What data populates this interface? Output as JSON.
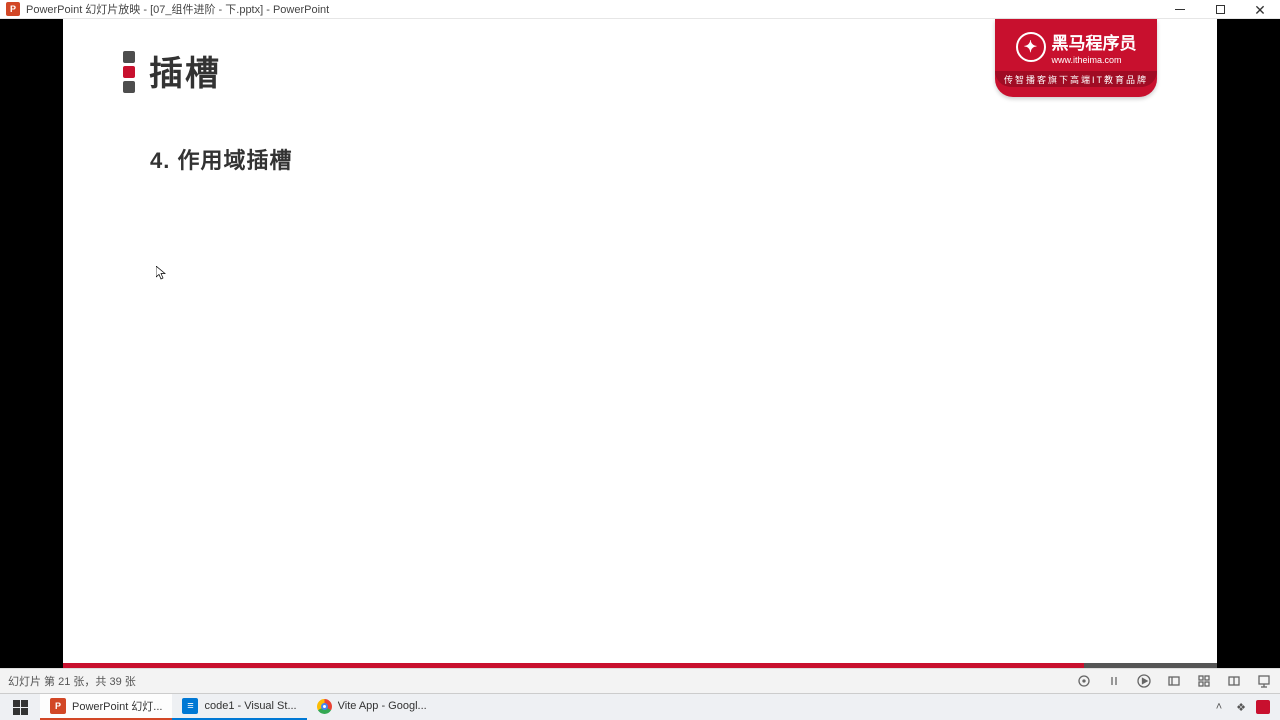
{
  "titlebar": {
    "app_icon_letter": "P",
    "title": "PowerPoint 幻灯片放映 - [07_组件进阶 - 下.pptx] - PowerPoint"
  },
  "slide": {
    "title": "插槽",
    "subtitle": "4. 作用域插槽",
    "progress_percent": 88.5
  },
  "logo": {
    "main": "黑马程序员",
    "url": "www.itheima.com",
    "tagline": "传智播客旗下高端IT教育品牌"
  },
  "statusbar": {
    "text": "幻灯片 第 21 张，共 39 张"
  },
  "taskbar": {
    "items": [
      {
        "label": "PowerPoint 幻灯..."
      },
      {
        "label": "code1 - Visual St..."
      },
      {
        "label": "Vite App - Googl..."
      }
    ]
  }
}
